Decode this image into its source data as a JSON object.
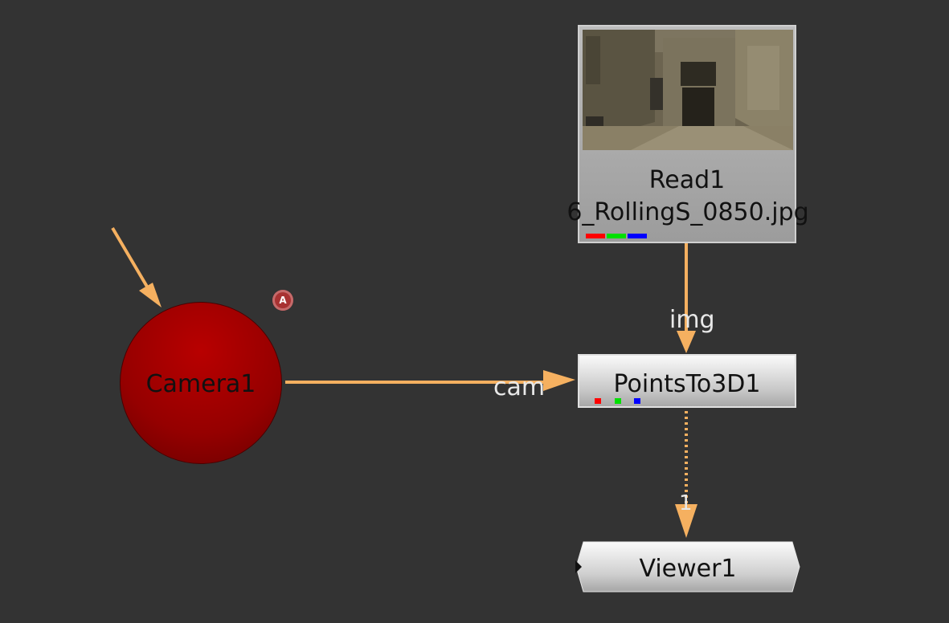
{
  "nodes": {
    "read": {
      "title": "Read1",
      "file": "6_RollingS_0850.jpg",
      "channel_colors": [
        "#ff0000",
        "#00e000",
        "#0000ff"
      ]
    },
    "points_to_3d": {
      "title": "PointsTo3D1",
      "channel_colors": [
        "#ff0000",
        "#00e000",
        "#0000ff"
      ]
    },
    "camera": {
      "title": "Camera1",
      "color": "#b00000",
      "badge": "A"
    },
    "viewer": {
      "title": "Viewer1"
    }
  },
  "edges": {
    "img_label": "img",
    "cam_label": "cam",
    "viewer_input_label": "1",
    "color": "#f5b060"
  },
  "colors": {
    "background": "#333333",
    "edge": "#f5b060",
    "camera": "#b00000"
  }
}
